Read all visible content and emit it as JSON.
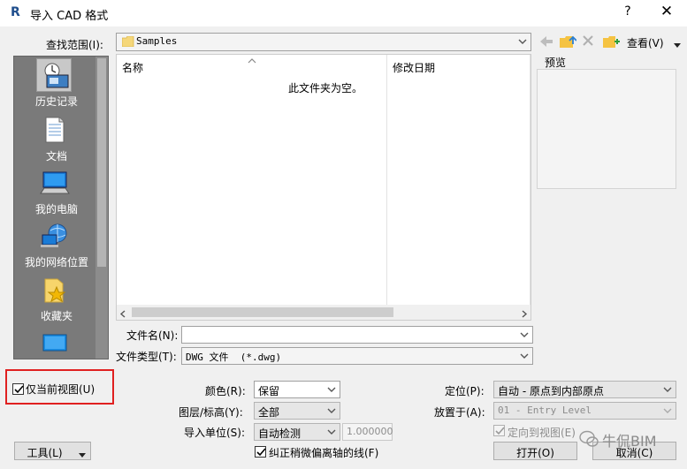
{
  "window": {
    "app_icon_letter": "R",
    "title": "导入 CAD 格式",
    "help": "?",
    "close": "✕"
  },
  "lookin": {
    "label": "查找范围(I):",
    "value": "Samples",
    "view_menu": "查看(V)"
  },
  "places": [
    {
      "label": "历史记录",
      "icon": "history-icon"
    },
    {
      "label": "文档",
      "icon": "document-icon"
    },
    {
      "label": "我的电脑",
      "icon": "computer-icon"
    },
    {
      "label": "我的网络位置",
      "icon": "network-icon"
    },
    {
      "label": "收藏夹",
      "icon": "favorites-icon"
    }
  ],
  "filelist": {
    "col_name": "名称",
    "col_modified": "修改日期",
    "empty_message": "此文件夹为空。"
  },
  "preview": {
    "label": "预览"
  },
  "filename": {
    "label": "文件名(N):",
    "value": ""
  },
  "filetype": {
    "label": "文件类型(T):",
    "value": "DWG 文件  (*.dwg)"
  },
  "current_view_only": {
    "label": "仅当前视图(U)",
    "checked": true
  },
  "colors": {
    "label": "颜色(R):",
    "value": "保留"
  },
  "layers": {
    "label": "图层/标高(Y):",
    "value": "全部"
  },
  "units": {
    "label": "导入单位(S):",
    "value": "自动检测",
    "scale": "1.000000"
  },
  "correct_lines": {
    "label": "纠正稍微偏离轴的线(F)",
    "checked": true
  },
  "positioning": {
    "label": "定位(P):",
    "value": "自动 - 原点到内部原点"
  },
  "place_at": {
    "label": "放置于(A):",
    "value": "01 - Entry Level"
  },
  "orient": {
    "label": "定向到视图(E)",
    "checked": true
  },
  "buttons": {
    "tools": "工具(L)",
    "open": "打开(O)",
    "cancel": "取消(C)"
  },
  "watermark": "牛侃BIM"
}
